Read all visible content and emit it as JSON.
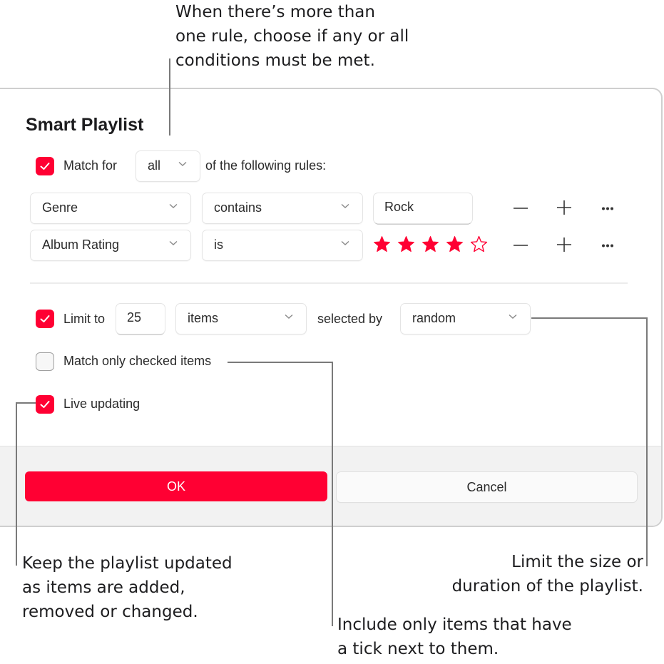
{
  "callouts": {
    "match_rule": "When there’s more than\none rule, choose if any or all\nconditions must be met.",
    "live_updating": "Keep the playlist updated\nas items are added,\nremoved or changed.",
    "limit": "Limit the size or\nduration of the playlist.",
    "checked_items": "Include only items that have\na tick next to them."
  },
  "dialog": {
    "title": "Smart Playlist",
    "match": {
      "checked": true,
      "label_before": "Match for",
      "mode": "all",
      "label_after": "of the following rules:"
    },
    "rules": [
      {
        "field": "Genre",
        "operator": "contains",
        "value": "Rock",
        "remove_icon": "minus-icon",
        "add_icon": "plus-icon",
        "more_icon": "ellipsis-icon"
      },
      {
        "field": "Album Rating",
        "operator": "is",
        "rating": 4,
        "rating_max": 5,
        "remove_icon": "minus-icon",
        "add_icon": "plus-icon",
        "more_icon": "ellipsis-icon"
      }
    ],
    "limit": {
      "checked": true,
      "label": "Limit to",
      "value": "25",
      "unit": "items",
      "selected_by_label": "selected by",
      "selected_by": "random"
    },
    "match_only_checked": {
      "checked": false,
      "label": "Match only checked items"
    },
    "live_updating": {
      "checked": true,
      "label": "Live updating"
    },
    "buttons": {
      "ok": "OK",
      "cancel": "Cancel"
    }
  },
  "colors": {
    "accent": "#ff0033",
    "leader_line": "#7a7a7a"
  }
}
